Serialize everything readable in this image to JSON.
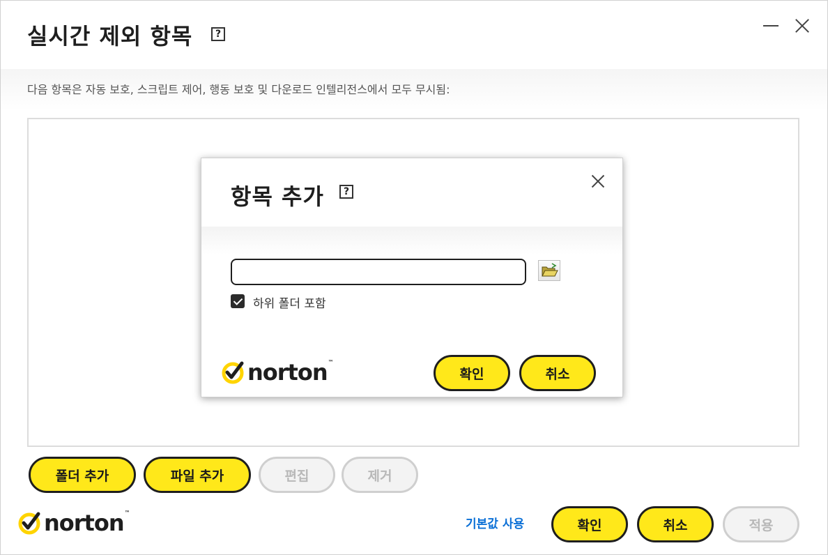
{
  "window": {
    "title": "실시간 제외 항목",
    "help_glyph": "?",
    "description": "다음 항목은 자동 보호, 스크립트 제어, 행동 보호 및 다운로드 인텔리전스에서 모두 무시됨:"
  },
  "list_buttons": {
    "add_folder": "폴더 추가",
    "add_file": "파일 추가",
    "edit": "편집",
    "remove": "제거"
  },
  "footer": {
    "brand": "norton",
    "tm": "™",
    "use_default": "기본값 사용",
    "ok": "확인",
    "cancel": "취소",
    "apply": "적용"
  },
  "dialog": {
    "title": "항목 추가",
    "help_glyph": "?",
    "path_value": "",
    "include_subfolders_label": "하위 폴더 포함",
    "include_subfolders_checked": true,
    "brand": "norton",
    "tm": "™",
    "ok": "확인",
    "cancel": "취소"
  },
  "colors": {
    "accent": "#ffe81a",
    "link": "#0a6fd6",
    "disabled_bg": "#f3f3f3",
    "disabled_text": "#b8b8b8"
  },
  "icons": [
    "minimize-icon",
    "close-icon",
    "help-icon",
    "folder-open-icon",
    "checkmark-icon",
    "norton-checkmark-logo"
  ]
}
